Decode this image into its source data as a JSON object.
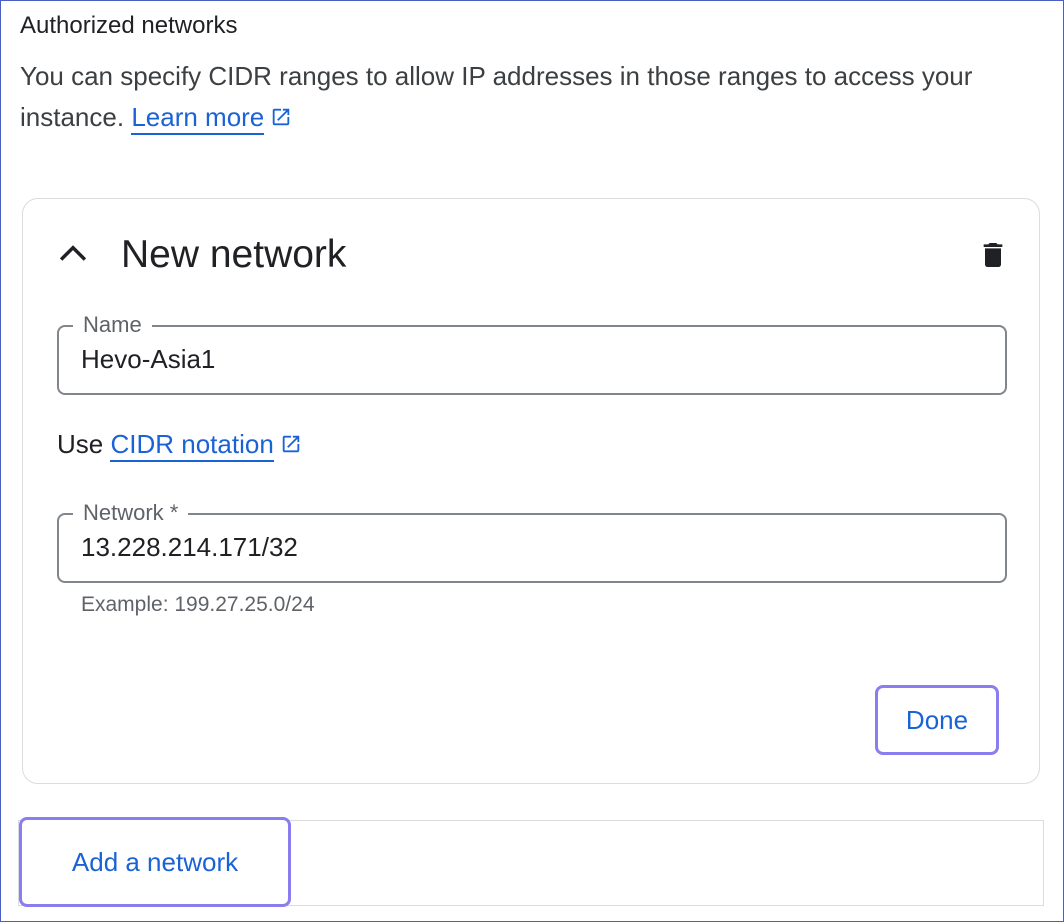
{
  "section": {
    "title": "Authorized networks",
    "description": "You can specify CIDR ranges to allow IP addresses in those ranges to access your instance.",
    "learn_more_label": "Learn more"
  },
  "network_card": {
    "title": "New network",
    "collapse_icon": "chevron-up-icon",
    "delete_icon": "trash-icon",
    "name_field": {
      "label": "Name",
      "value": "Hevo-Asia1"
    },
    "cidr_prefix": "Use",
    "cidr_link_label": "CIDR notation",
    "network_field": {
      "label": "Network *",
      "value": "13.228.214.171/32",
      "hint": "Example: 199.27.25.0/24"
    },
    "done_label": "Done"
  },
  "add_network_label": "Add a network",
  "colors": {
    "link": "#1a63d6",
    "focus_ring": "#8a7df0",
    "border": "#dadce0",
    "field_border": "#80868b"
  }
}
